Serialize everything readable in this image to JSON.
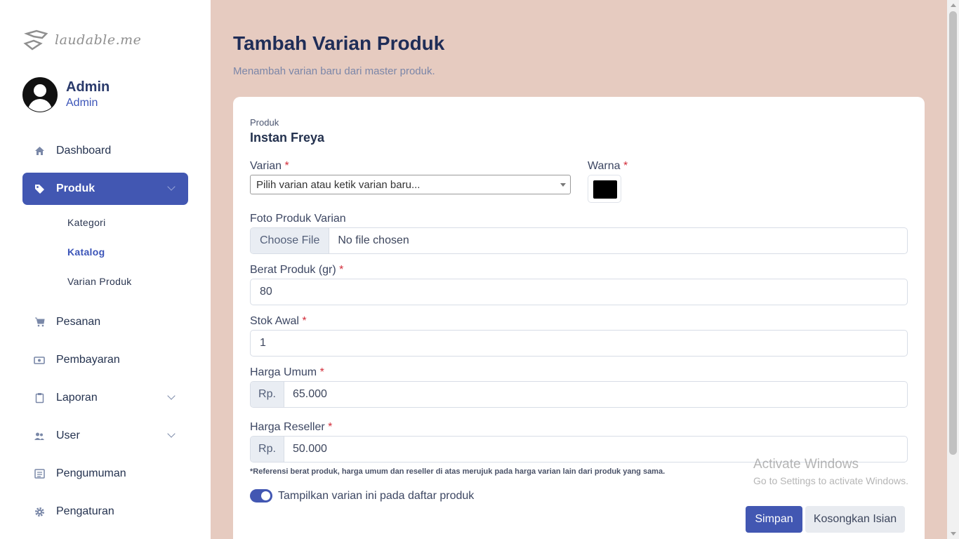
{
  "brand": {
    "logo_text": "laudable.me"
  },
  "profile": {
    "name": "Admin",
    "role": "Admin"
  },
  "sidebar": {
    "items": [
      {
        "label": "Dashboard",
        "icon": "home-icon"
      },
      {
        "label": "Produk",
        "icon": "tag-icon",
        "active": true,
        "expandable": true
      },
      {
        "label": "Pesanan",
        "icon": "cart-icon"
      },
      {
        "label": "Pembayaran",
        "icon": "cash-icon"
      },
      {
        "label": "Laporan",
        "icon": "clipboard-icon",
        "expandable": true
      },
      {
        "label": "User",
        "icon": "users-icon",
        "expandable": true
      },
      {
        "label": "Pengumuman",
        "icon": "newspaper-icon"
      },
      {
        "label": "Pengaturan",
        "icon": "gear-icon"
      }
    ],
    "produk_sub": [
      "Kategori",
      "Katalog",
      "Varian Produk"
    ]
  },
  "page": {
    "title": "Tambah Varian Produk",
    "subtitle": "Menambah varian baru dari master produk."
  },
  "form": {
    "produk_label": "Produk",
    "produk_value": "Instan Freya",
    "varian_label": "Varian",
    "varian_placeholder": "Pilih varian atau ketik varian baru...",
    "warna_label": "Warna",
    "warna_value": "#000000",
    "foto_label": "Foto Produk Varian",
    "foto_button": "Choose File",
    "foto_status": "No file chosen",
    "berat_label": "Berat Produk (gr)",
    "berat_value": "80",
    "stok_label": "Stok Awal",
    "stok_value": "1",
    "harga_umum_label": "Harga Umum",
    "harga_umum_prefix": "Rp.",
    "harga_umum_value": "65.000",
    "harga_reseller_label": "Harga Reseller",
    "harga_reseller_prefix": "Rp.",
    "harga_reseller_value": "50.000",
    "required_mark": "*",
    "note": "*Referensi berat produk, harga umum dan reseller di atas merujuk pada harga varian lain dari produk yang sama.",
    "toggle_label": "Tampilkan varian ini pada daftar produk",
    "toggle_on": true,
    "save_button": "Simpan",
    "reset_button": "Kosongkan Isian"
  },
  "watermark": {
    "line1": "Activate Windows",
    "line2": "Go to Settings to activate Windows."
  },
  "colors": {
    "accent": "#4257b2",
    "background": "#e6cbc0"
  }
}
